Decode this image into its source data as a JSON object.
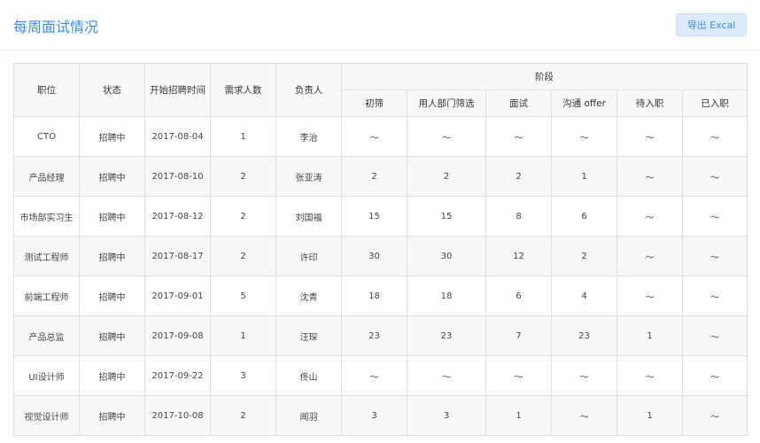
{
  "header": {
    "title": "每周面试情况",
    "export_label": "导出 Excal"
  },
  "table": {
    "columns": {
      "position": "职位",
      "status": "状态",
      "start": "开始招聘时间",
      "demand": "需求人数",
      "owner": "负责人",
      "stage": "阶段",
      "screen": "初筛",
      "dept_screen": "用人部门筛选",
      "interview": "面试",
      "offer": "沟通 offer",
      "pending": "待入职",
      "joined": "已入职"
    },
    "rows": [
      [
        "CTO",
        "招聘中",
        "2017-08-04",
        "1",
        "李治",
        "～",
        "～",
        "～",
        "～",
        "～",
        "～"
      ],
      [
        "产品经理",
        "招聘中",
        "2017-08-10",
        "2",
        "张亚涛",
        "2",
        "2",
        "2",
        "1",
        "～",
        "～"
      ],
      [
        "市场部实习生",
        "招聘中",
        "2017-08-12",
        "2",
        "刘国福",
        "15",
        "15",
        "8",
        "6",
        "～",
        "～"
      ],
      [
        "测试工程师",
        "招聘中",
        "2017-08-17",
        "2",
        "许印",
        "30",
        "30",
        "12",
        "2",
        "～",
        "～"
      ],
      [
        "前端工程师",
        "招聘中",
        "2017-09-01",
        "5",
        "沈青",
        "18",
        "18",
        "6",
        "4",
        "～",
        "～"
      ],
      [
        "产品总监",
        "招聘中",
        "2017-09-08",
        "1",
        "汪琛",
        "23",
        "23",
        "7",
        "23",
        "1",
        "～"
      ],
      [
        "UI设计师",
        "招聘中",
        "2017-09-22",
        "3",
        "佟山",
        "～",
        "～",
        "～",
        "～",
        "～",
        "～"
      ],
      [
        "视觉设计师",
        "招聘中",
        "2017-10-08",
        "2",
        "闻羽",
        "3",
        "3",
        "1",
        "～",
        "1",
        "～"
      ]
    ]
  }
}
